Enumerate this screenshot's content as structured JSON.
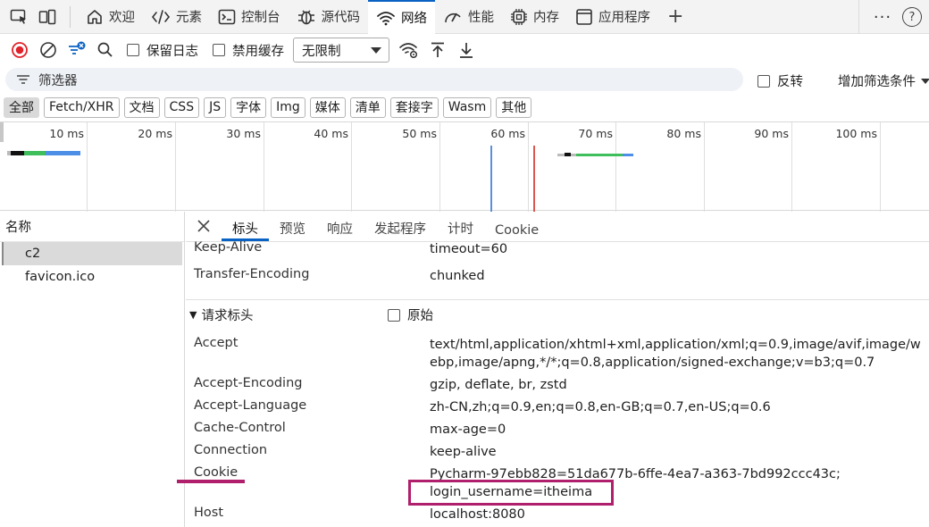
{
  "tabs": [
    {
      "label": "欢迎",
      "icon": "home-icon"
    },
    {
      "label": "元素",
      "icon": "code-icon"
    },
    {
      "label": "控制台",
      "icon": "console-icon"
    },
    {
      "label": "源代码",
      "icon": "bug-icon"
    },
    {
      "label": "网络",
      "icon": "wifi-icon",
      "active": true
    },
    {
      "label": "性能",
      "icon": "performance-icon"
    },
    {
      "label": "内存",
      "icon": "memory-chip-icon"
    },
    {
      "label": "应用程序",
      "icon": "application-icon"
    }
  ],
  "toolbar": {
    "preserve_log": "保留日志",
    "disable_cache": "禁用缓存",
    "throttle_value": "无限制"
  },
  "filter": {
    "placeholder": "筛选器",
    "invert": "反转",
    "add_filter": "增加筛选条件"
  },
  "type_chips": [
    "全部",
    "Fetch/XHR",
    "文档",
    "CSS",
    "JS",
    "字体",
    "Img",
    "媒体",
    "清单",
    "套接字",
    "Wasm",
    "其他"
  ],
  "timeline": {
    "ticks": [
      "10 ms",
      "20 ms",
      "30 ms",
      "40 ms",
      "50 ms",
      "60 ms",
      "70 ms",
      "80 ms",
      "90 ms",
      "100 ms"
    ]
  },
  "requests": {
    "header": "名称",
    "items": [
      "c2",
      "favicon.ico"
    ]
  },
  "detail_tabs": [
    "标头",
    "预览",
    "响应",
    "发起程序",
    "计时",
    "Cookie"
  ],
  "response_headers": [
    {
      "key": "Keep-Alive",
      "value": "timeout=60"
    },
    {
      "key": "Transfer-Encoding",
      "value": "chunked"
    }
  ],
  "request_section": {
    "title": "请求标头",
    "raw_label": "原始"
  },
  "request_headers": [
    {
      "key": "Accept",
      "value": "text/html,application/xhtml+xml,application/xml;q=0.9,image/avif,image/webp,image/apng,*/*;q=0.8,application/signed-exchange;v=b3;q=0.7"
    },
    {
      "key": "Accept-Encoding",
      "value": "gzip, deflate, br, zstd"
    },
    {
      "key": "Accept-Language",
      "value": "zh-CN,zh;q=0.9,en;q=0.8,en-GB;q=0.7,en-US;q=0.6"
    },
    {
      "key": "Cache-Control",
      "value": "max-age=0"
    },
    {
      "key": "Connection",
      "value": "keep-alive"
    },
    {
      "key": "Cookie",
      "value": "Pycharm-97ebb828=51da677b-6ffe-4ea7-a363-7bd992ccc43c;",
      "value2": "login_username=itheima"
    },
    {
      "key": "Host",
      "value": "localhost:8080"
    }
  ],
  "colors": {
    "accent": "#0a62c4",
    "annotation": "#b01f6b",
    "record": "#e0222a"
  }
}
